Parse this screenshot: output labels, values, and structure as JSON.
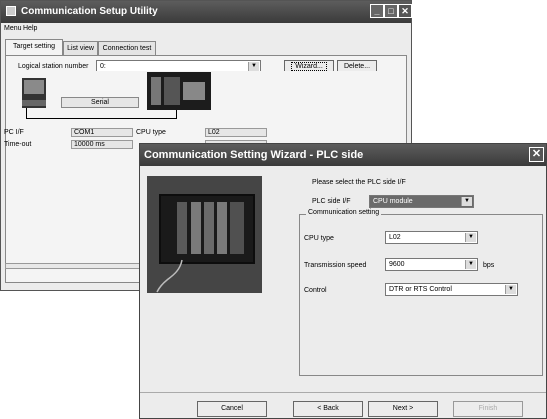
{
  "utility": {
    "title": "Communication Setup Utility",
    "menu": [
      "Menu",
      "Help"
    ],
    "tabs": [
      "Target setting",
      "List view",
      "Connection test"
    ],
    "logical_station_label": "Logical station number",
    "logical_station_value": "0:",
    "wizard_button": "Wizard...",
    "delete_button": "Delete...",
    "serial_label": "Serial",
    "pc_if_label": "PC I/F",
    "pc_if_value": "COM1",
    "timeout_label": "Time-out",
    "timeout_value": "10000 ms",
    "cpu_type_label": "CPU type",
    "cpu_type_value": "L02"
  },
  "wizard": {
    "title": "Communication Setting Wizard - PLC side",
    "prompt": "Please select the PLC side I/F",
    "plc_if_label": "PLC side I/F",
    "plc_if_value": "CPU module",
    "group_label": "Communication setting",
    "cpu_type_label": "CPU type",
    "cpu_type_value": "L02",
    "speed_label": "Transmission speed",
    "speed_value": "9600",
    "speed_unit": "bps",
    "control_label": "Control",
    "control_value": "DTR or RTS Control",
    "buttons": {
      "cancel": "Cancel",
      "back": "< Back",
      "next": "Next >",
      "finish": "Finish"
    }
  },
  "colors": {
    "titlebar": "#4a4a4a",
    "selected_dropdown": "#6a6a6a"
  }
}
